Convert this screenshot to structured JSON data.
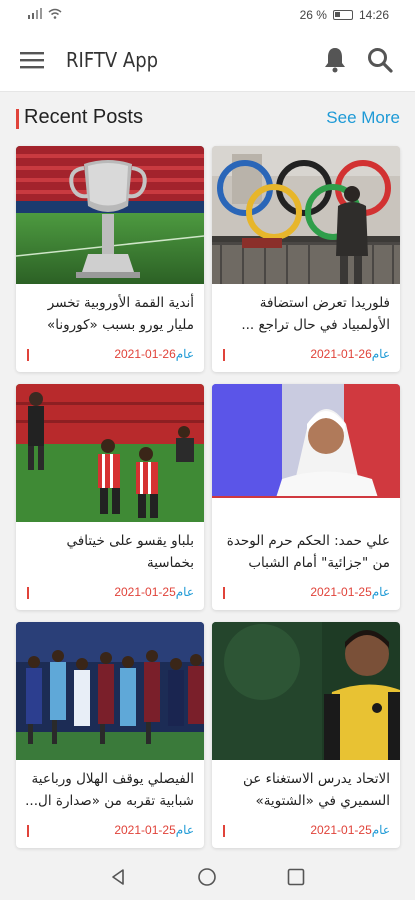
{
  "status_bar": {
    "battery": "26 %",
    "time": "14:26"
  },
  "app_bar": {
    "title": "RIFTV App"
  },
  "section": {
    "title": "Recent Posts",
    "see_more": "See More"
  },
  "colors": {
    "accent_red": "#e0433a",
    "link_blue": "#1e9ad6"
  },
  "posts": [
    {
      "title": "فلوريدا تعرض استضافة الأولمبياد في حال تراجع ...",
      "date": "26-01-2021",
      "suffix": "عام",
      "image": "olympic-rings"
    },
    {
      "title": "أندية القمة الأوروبية تخسر مليار يورو بسبب «كورونا»",
      "date": "26-01-2021",
      "suffix": "عام",
      "image": "champions-trophy"
    },
    {
      "title": "علي حمد: الحكم حرم الوحدة من \"جزائية\" أمام الشباب",
      "date": "25-01-2021",
      "suffix": "عام",
      "image": "tv-interview"
    },
    {
      "title": "بلباو يقسو على خيتافي بخماسية",
      "date": "25-01-2021",
      "suffix": "عام",
      "image": "bilbao-players"
    },
    {
      "title": "الاتحاد يدرس الاستغناء عن السميري في «الشتوية»",
      "date": "25-01-2021",
      "suffix": "عام",
      "image": "ittihad-player"
    },
    {
      "title": "الفيصلي يوقف الهلال ورباعية شبابية تقربه من «صدارة ال...",
      "date": "25-01-2021",
      "suffix": "عام",
      "image": "faisaly-match"
    }
  ]
}
